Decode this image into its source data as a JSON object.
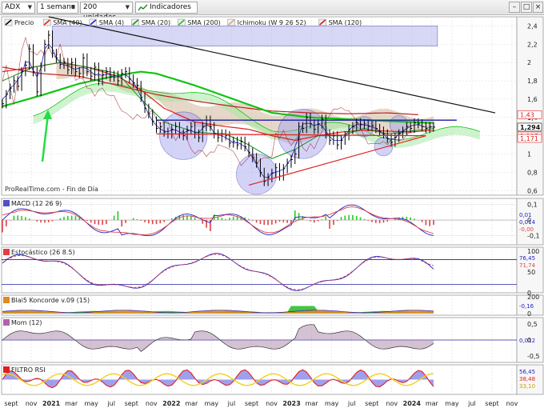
{
  "toolbar": {
    "ticker": "ADX",
    "period": "1 semana",
    "units": "200 unidades",
    "indicators_label": "Indicadores"
  },
  "colors": {
    "sma40": "#e02020",
    "sma4": "#2020c8",
    "sma20": "#10901a",
    "sma200": "#12c412",
    "ichimoku_cloud": "#c8a888",
    "sma120": "#c02020",
    "price": "#000000"
  },
  "legend": [
    {
      "label": "Precio",
      "icon": "price-icon"
    },
    {
      "label": "SMA (40)",
      "icon": "sma40-icon"
    },
    {
      "label": "SMA (4)",
      "icon": "sma4-icon"
    },
    {
      "label": "SMA (20)",
      "icon": "sma20-icon"
    },
    {
      "label": "SMA (200)",
      "icon": "sma200-icon"
    },
    {
      "label": "Ichimoku (W 9 26 52)",
      "icon": "ichimoku-icon"
    },
    {
      "label": "SMA (120)",
      "icon": "sma120-icon"
    }
  ],
  "source_label": "ProRealTime.com - Fin de Día",
  "chart_data": [
    {
      "type": "line",
      "panel": "price",
      "ylim": [
        0.55,
        2.5
      ],
      "yticks": [
        "2,4",
        "2,2",
        "2",
        "1,8",
        "1,6",
        "1,4",
        "1,2",
        "1",
        "0,8",
        "0,6"
      ],
      "ytick_values": [
        2.4,
        2.2,
        2.0,
        1.8,
        1.6,
        1.4,
        1.2,
        1.0,
        0.8,
        0.6
      ],
      "value_labels": [
        {
          "text": "1,43",
          "value": 1.43,
          "color": "#e02020"
        },
        {
          "text": "1,294",
          "value": 1.294,
          "color": "#111111"
        },
        {
          "text": "1,197",
          "value": 1.197,
          "color": "#e02020"
        },
        {
          "text": "1,171",
          "value": 1.171,
          "color": "#e02020"
        }
      ],
      "price_series": [
        [
          0,
          1.55
        ],
        [
          1,
          1.65
        ],
        [
          2,
          1.72
        ],
        [
          3,
          1.8
        ],
        [
          4,
          1.74
        ],
        [
          5,
          1.9
        ],
        [
          6,
          1.97
        ],
        [
          7,
          2.15
        ],
        [
          8,
          1.9
        ],
        [
          9,
          1.68
        ],
        [
          10,
          1.95
        ],
        [
          11,
          2.2
        ],
        [
          12,
          2.3
        ],
        [
          13,
          2.1
        ],
        [
          14,
          2.05
        ],
        [
          15,
          1.98
        ],
        [
          16,
          2.0
        ],
        [
          17,
          1.92
        ],
        [
          18,
          2.0
        ],
        [
          19,
          1.9
        ],
        [
          20,
          1.88
        ],
        [
          21,
          2.05
        ],
        [
          22,
          1.9
        ],
        [
          23,
          1.85
        ],
        [
          24,
          1.95
        ],
        [
          25,
          1.8
        ],
        [
          26,
          1.87
        ],
        [
          27,
          1.9
        ],
        [
          28,
          1.84
        ],
        [
          29,
          1.86
        ],
        [
          30,
          1.8
        ],
        [
          31,
          1.88
        ],
        [
          32,
          1.9
        ],
        [
          33,
          1.82
        ],
        [
          34,
          1.78
        ],
        [
          35,
          1.75
        ],
        [
          36,
          1.62
        ],
        [
          37,
          1.5
        ],
        [
          38,
          1.44
        ],
        [
          39,
          1.36
        ],
        [
          40,
          1.28
        ],
        [
          41,
          1.3
        ],
        [
          42,
          1.24
        ],
        [
          43,
          1.22
        ],
        [
          44,
          1.27
        ],
        [
          45,
          1.3
        ],
        [
          46,
          1.22
        ],
        [
          47,
          1.2
        ],
        [
          48,
          1.26
        ],
        [
          49,
          1.3
        ],
        [
          50,
          1.22
        ],
        [
          51,
          1.18
        ],
        [
          52,
          1.3
        ],
        [
          53,
          1.37
        ],
        [
          54,
          1.3
        ],
        [
          55,
          1.22
        ],
        [
          56,
          1.18
        ],
        [
          57,
          1.22
        ],
        [
          58,
          1.2
        ],
        [
          59,
          1.12
        ],
        [
          60,
          1.14
        ],
        [
          61,
          1.1
        ],
        [
          62,
          1.14
        ],
        [
          63,
          1.08
        ],
        [
          64,
          1.02
        ],
        [
          65,
          0.96
        ],
        [
          66,
          0.9
        ],
        [
          67,
          0.8
        ],
        [
          68,
          0.7
        ],
        [
          69,
          0.74
        ],
        [
          70,
          0.79
        ],
        [
          71,
          0.85
        ],
        [
          72,
          0.76
        ],
        [
          73,
          0.84
        ],
        [
          74,
          0.9
        ],
        [
          75,
          0.94
        ],
        [
          76,
          1.0
        ],
        [
          77,
          1.3
        ],
        [
          78,
          1.28
        ],
        [
          79,
          1.4
        ],
        [
          80,
          1.33
        ],
        [
          81,
          1.27
        ],
        [
          82,
          1.33
        ],
        [
          83,
          1.38
        ],
        [
          84,
          1.22
        ],
        [
          85,
          1.15
        ],
        [
          86,
          1.2
        ],
        [
          87,
          1.1
        ],
        [
          88,
          1.15
        ],
        [
          89,
          1.2
        ],
        [
          90,
          1.27
        ],
        [
          91,
          1.3
        ],
        [
          92,
          1.34
        ],
        [
          93,
          1.32
        ],
        [
          94,
          1.33
        ],
        [
          95,
          1.3
        ],
        [
          96,
          1.31
        ],
        [
          97,
          1.28
        ],
        [
          98,
          1.25
        ],
        [
          99,
          1.22
        ],
        [
          100,
          1.17
        ],
        [
          101,
          1.13
        ],
        [
          102,
          1.18
        ],
        [
          103,
          1.22
        ],
        [
          104,
          1.25
        ],
        [
          105,
          1.3
        ],
        [
          106,
          1.28
        ],
        [
          107,
          1.34
        ],
        [
          108,
          1.33
        ],
        [
          109,
          1.3
        ],
        [
          110,
          1.28
        ],
        [
          111,
          1.3
        ],
        [
          112,
          1.294
        ]
      ],
      "sma120_series": [
        [
          0,
          1.95
        ],
        [
          10,
          1.88
        ],
        [
          20,
          1.85
        ],
        [
          30,
          1.75
        ],
        [
          40,
          1.65
        ],
        [
          50,
          1.58
        ],
        [
          60,
          1.52
        ],
        [
          70,
          1.47
        ],
        [
          80,
          1.45
        ],
        [
          90,
          1.44
        ],
        [
          100,
          1.45
        ],
        [
          108,
          1.43
        ]
      ],
      "sma40_series": [
        [
          0,
          1.9
        ],
        [
          8,
          1.95
        ],
        [
          15,
          2.0
        ],
        [
          22,
          1.95
        ],
        [
          30,
          1.85
        ],
        [
          36,
          1.7
        ],
        [
          42,
          1.5
        ],
        [
          50,
          1.35
        ],
        [
          58,
          1.3
        ],
        [
          64,
          1.27
        ],
        [
          70,
          1.2
        ],
        [
          76,
          1.15
        ],
        [
          82,
          1.2
        ],
        [
          88,
          1.24
        ],
        [
          94,
          1.26
        ],
        [
          100,
          1.25
        ],
        [
          106,
          1.24
        ],
        [
          112,
          1.26
        ]
      ],
      "sma20_series": [
        [
          0,
          1.8
        ],
        [
          8,
          1.95
        ],
        [
          15,
          2.0
        ],
        [
          22,
          1.95
        ],
        [
          30,
          1.88
        ],
        [
          36,
          1.6
        ],
        [
          42,
          1.35
        ],
        [
          50,
          1.24
        ],
        [
          58,
          1.22
        ],
        [
          64,
          1.1
        ],
        [
          70,
          0.95
        ],
        [
          76,
          1.05
        ],
        [
          82,
          1.2
        ],
        [
          88,
          1.2
        ],
        [
          94,
          1.28
        ],
        [
          100,
          1.22
        ],
        [
          106,
          1.25
        ],
        [
          112,
          1.28
        ]
      ],
      "sma200_series": [
        [
          0,
          1.52
        ],
        [
          10,
          1.64
        ],
        [
          20,
          1.77
        ],
        [
          30,
          1.86
        ],
        [
          36,
          1.9
        ],
        [
          40,
          1.88
        ],
        [
          50,
          1.75
        ],
        [
          60,
          1.6
        ],
        [
          70,
          1.45
        ],
        [
          80,
          1.4
        ],
        [
          90,
          1.38
        ],
        [
          100,
          1.36
        ],
        [
          112,
          1.34
        ]
      ],
      "annotations": [
        {
          "type": "rect",
          "x0": 13,
          "x1": 113,
          "y0": 2.4,
          "y1": 2.18
        },
        {
          "type": "trendline",
          "points": [
            [
              12,
              2.5
            ],
            [
              128,
              1.45
            ]
          ],
          "color": "#111111"
        },
        {
          "type": "trendline",
          "points": [
            [
              64,
              0.66
            ],
            [
              110,
              1.2
            ]
          ],
          "color": "#e02020"
        },
        {
          "type": "trendline",
          "points": [
            [
              40,
              1.22
            ],
            [
              110,
              1.2
            ]
          ],
          "color": "#e02020"
        },
        {
          "type": "hline",
          "x0": 40,
          "x1": 118,
          "value": 1.37,
          "color": "#1a1a99"
        },
        {
          "type": "circle",
          "x": 47,
          "y": 1.2,
          "r": 0.26
        },
        {
          "type": "circle",
          "x": 66,
          "y": 0.78,
          "r": 0.22
        },
        {
          "type": "circle",
          "x": 78,
          "y": 1.22,
          "r": 0.27
        },
        {
          "type": "circle",
          "x": 94,
          "y": 1.3,
          "r": 0.11
        },
        {
          "type": "circle",
          "x": 99,
          "y": 1.08,
          "r": 0.1
        },
        {
          "type": "circle",
          "x": 103,
          "y": 1.32,
          "r": 0.1
        }
      ]
    },
    {
      "type": "bar",
      "panel": "macd",
      "title": "MACD (12 26 9)",
      "ylim": [
        -0.16,
        0.14
      ],
      "yticks": [
        "0,1",
        "0",
        "-0,1"
      ],
      "ytick_values": [
        0.1,
        0.0,
        -0.1
      ],
      "value_labels": [
        "0,01",
        "0,014",
        "-0,00"
      ]
    },
    {
      "type": "line",
      "panel": "stochastic",
      "title": "Estocástico (26 8.5)",
      "ylim": [
        0,
        110
      ],
      "yticks": [
        "100",
        "50",
        "0"
      ],
      "ytick_values": [
        100,
        50,
        0
      ],
      "value_labels": [
        "76,45",
        "71,74"
      ]
    },
    {
      "type": "area",
      "panel": "koncorde",
      "title": "Blai5 Koncorde v.09 (15)",
      "ylim": [
        -20,
        220
      ],
      "yticks": [
        "200",
        "0"
      ],
      "ytick_values": [
        200,
        0
      ],
      "value_labels": [
        "-0,16"
      ]
    },
    {
      "type": "area",
      "panel": "momentum",
      "title": "Mom (12)",
      "ylim": [
        -0.7,
        0.7
      ],
      "yticks": [
        "0,5",
        "0",
        "-0,5"
      ],
      "ytick_values": [
        0.5,
        0.0,
        -0.5
      ],
      "value_labels": [
        "0,012"
      ]
    },
    {
      "type": "line",
      "panel": "filtro_rsi",
      "title": "FILTRO RSI",
      "ylim": [
        20,
        80
      ],
      "yticks": [],
      "ytick_values": [],
      "value_labels": [
        "56,45",
        "38,48",
        "33,10"
      ]
    }
  ],
  "x_axis": [
    {
      "label": "sept",
      "bold": false
    },
    {
      "label": "nov",
      "bold": false
    },
    {
      "label": "2021",
      "bold": true
    },
    {
      "label": "mar",
      "bold": false
    },
    {
      "label": "may",
      "bold": false
    },
    {
      "label": "jul",
      "bold": false
    },
    {
      "label": "sept",
      "bold": false
    },
    {
      "label": "nov",
      "bold": false
    },
    {
      "label": "2022",
      "bold": true
    },
    {
      "label": "mar",
      "bold": false
    },
    {
      "label": "may",
      "bold": false
    },
    {
      "label": "jul",
      "bold": false
    },
    {
      "label": "sept",
      "bold": false
    },
    {
      "label": "nov",
      "bold": false
    },
    {
      "label": "2023",
      "bold": true
    },
    {
      "label": "mar",
      "bold": false
    },
    {
      "label": "may",
      "bold": false
    },
    {
      "label": "jul",
      "bold": false
    },
    {
      "label": "sept",
      "bold": false
    },
    {
      "label": "nov",
      "bold": false
    },
    {
      "label": "2024",
      "bold": true
    },
    {
      "label": "mar",
      "bold": false
    },
    {
      "label": "may",
      "bold": false
    },
    {
      "label": "jul",
      "bold": false
    },
    {
      "label": "sept",
      "bold": false
    },
    {
      "label": "nov",
      "bold": false
    }
  ]
}
